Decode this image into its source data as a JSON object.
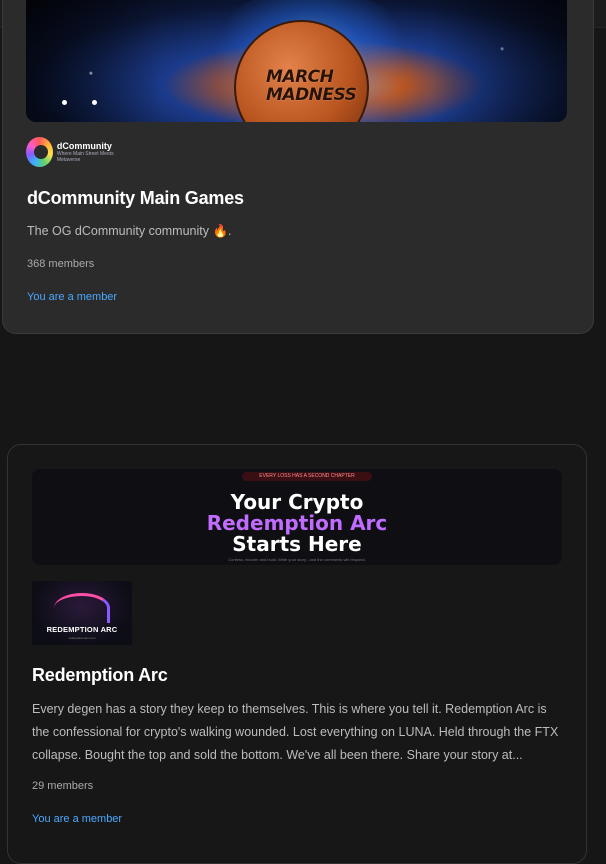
{
  "communities": [
    {
      "banner_text": "MARCH MADNESS",
      "logo": {
        "name": "dCommunity",
        "tagline": "Where Main Street Meets Metaverse"
      },
      "title": "dCommunity Main Games",
      "description": "The OG dCommunity community 🔥.",
      "members": "368 members",
      "status": "You are a member"
    },
    {
      "banner": {
        "pill": "EVERY LOSS HAS A SECOND CHAPTER",
        "line1": "Your Crypto",
        "line2": "Redemption Arc",
        "line3": "Starts Here",
        "fine": "Confess, recover and build. Write your story - and the comments will respond."
      },
      "logo": {
        "name": "REDEMPTION ARC",
        "sub": "redemption-arc.com"
      },
      "title": "Redemption Arc",
      "description": "Every degen has a story they keep to themselves. This is where you tell it. Redemption Arc is the confessional for crypto's walking wounded. Lost everything on LUNA. Held through the FTX collapse. Bought the top and sold the bottom. We've all been there. Share your story at...",
      "members": "29 members",
      "status": "You are a member"
    }
  ],
  "colors": {
    "link": "#4aa8ff",
    "accent_purple": "#c06cff"
  }
}
